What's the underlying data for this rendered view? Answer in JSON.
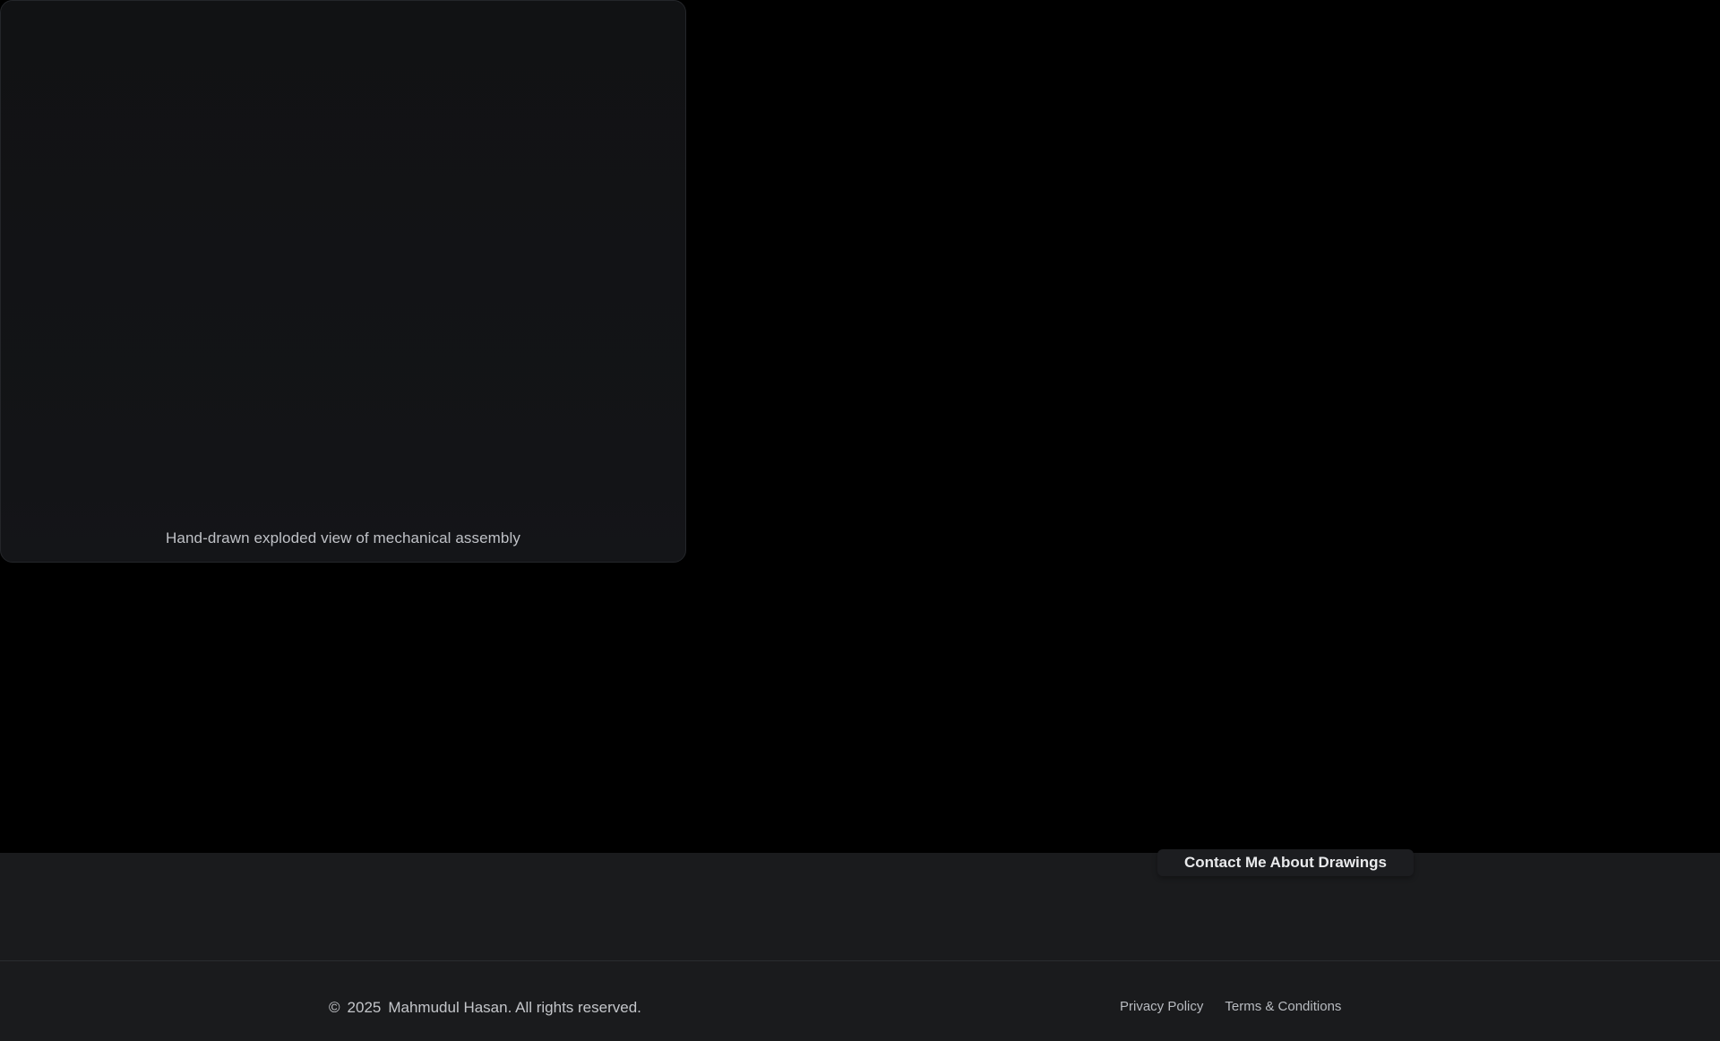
{
  "gallery": {
    "drawing_caption": "Hand-drawn exploded view of mechanical assembly"
  },
  "cta": {
    "contact_label": "Contact Me About Drawings"
  },
  "footer": {
    "copyright_symbol": "©",
    "year": "2025",
    "owner_text": "Mahmudul Hasan. All rights reserved.",
    "links": {
      "privacy": "Privacy Policy",
      "terms": "Terms & Conditions"
    }
  },
  "colors": {
    "background": "#000000",
    "band": "#1a1b1d",
    "text_primary": "#e9eaec",
    "text_secondary": "#c4c6ca"
  }
}
